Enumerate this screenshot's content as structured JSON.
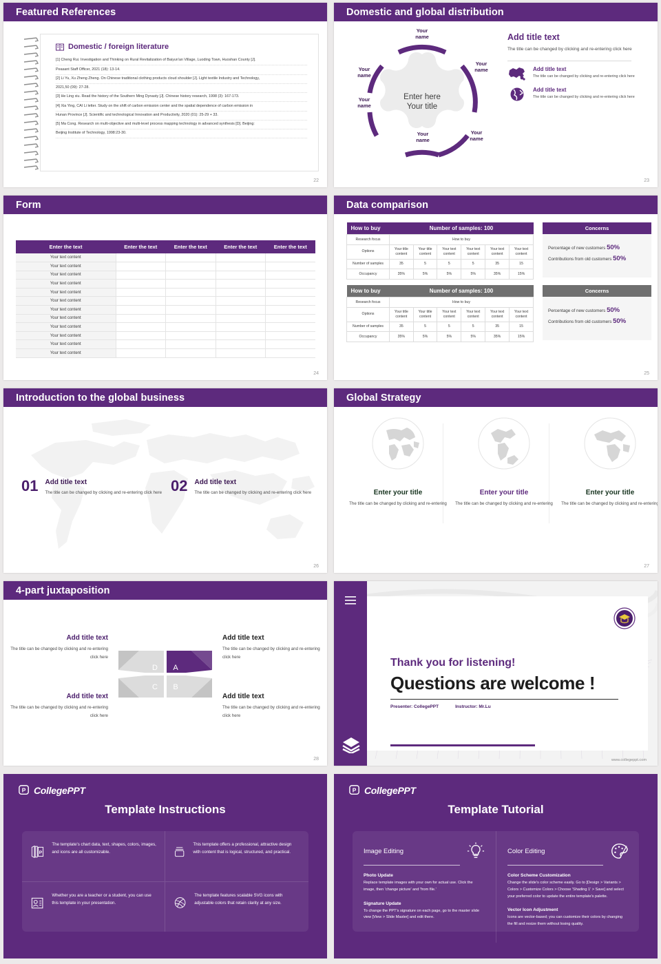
{
  "theme": {
    "purple": "#5d2a7d",
    "grey": "#6f6f6f",
    "dark": "#1d1d1d"
  },
  "slides": {
    "references": {
      "title": "Featured References",
      "page": "22",
      "card_title": "Domestic / foreign literature",
      "entries": [
        "[1] Cheng Rui. Investigation and Thinking on Rural Revitalization of Baiyun'an Village, Luoding Town, Huoshan County [J].",
        "Peasant Staff Officer, 2021 (18): 13-14.",
        "[2] Li Yu, Xu Zheng Zheng. On Chinese traditional clothing products cloud shoulder [J]. Light textile Industry and Technology,",
        "2021,50 (09): 27-28.",
        "[3] He Ling xiu. Read the history of the Southern Ming Dynasty [J]. Chinese history research, 1998 (3): 167-173.",
        "[4] Xia Ying, CAI Li letter. Study on the shift of carbon emission center and the spatial dependence of carbon emission in",
        "Hunan Province [J]. Scientific and technological Innovation and Productivity, 2020 (01): 25-29 + 33.",
        "[5] Ma Cong. Research on multi-objective and multi-level process mapping technology in advanced synthesis [D]. Beijing:",
        "Beijing Institute of Technology, 1998:23-30."
      ]
    },
    "distribution": {
      "title": "Domestic and global distribution",
      "page": "23",
      "center_line1": "Enter here",
      "center_line2": "Your title",
      "node_label": "Your\nname",
      "nodes": [
        "Your name",
        "Your name",
        "Your name",
        "Your name",
        "Your name",
        "Your name"
      ],
      "right_title": "Add title text",
      "right_body": "The title can be changed by clicking and re-entering click here",
      "items": [
        {
          "icon": "china-map-icon",
          "title": "Add title text",
          "body": "The title can be changed by clicking and re-entering click here"
        },
        {
          "icon": "globe-icon",
          "title": "Add title text",
          "body": "The title can be changed by clicking and re-entering click here"
        }
      ]
    },
    "form": {
      "title": "Form",
      "page": "24",
      "headers": [
        "Enter the text",
        "Enter the text",
        "Enter the text",
        "Enter the text",
        "Enter the text"
      ],
      "row_label": "Your text content",
      "row_count": 12
    },
    "comparison": {
      "title": "Data comparison",
      "page": "25",
      "tables": [
        {
          "accent": "purple",
          "bar_left": "How to buy",
          "bar_right": "Number of samples: 100",
          "focus_label": "Research focus",
          "focus_value": "How to buy",
          "options_label": "Options",
          "options": [
            "Your title content",
            "Your title content",
            "Your text content",
            "Your text content",
            "Your text content",
            "Your text content"
          ],
          "samples_label": "Number of samples",
          "samples": [
            "35",
            "5",
            "5",
            "5",
            "35",
            "15"
          ],
          "occupancy_label": "Occupancy",
          "occupancy": [
            "35%",
            "5%",
            "5%",
            "5%",
            "35%",
            "15%"
          ]
        },
        {
          "accent": "grey",
          "bar_left": "How to buy",
          "bar_right": "Number of samples: 100",
          "focus_label": "Research focus",
          "focus_value": "How to buy",
          "options_label": "Options",
          "options": [
            "Your title content",
            "Your title content",
            "Your text content",
            "Your text content",
            "Your text content",
            "Your text content"
          ],
          "samples_label": "Number of samples",
          "samples": [
            "35",
            "5",
            "5",
            "5",
            "35",
            "15"
          ],
          "occupancy_label": "Occupancy",
          "occupancy": [
            "35%",
            "5%",
            "5%",
            "5%",
            "35%",
            "15%"
          ]
        }
      ],
      "concerns": [
        {
          "accent": "purple",
          "caption": "Concerns",
          "line1": "Percentage of new customers",
          "value1": "50%",
          "line2": "Contributions from old customers",
          "value2": "50%"
        },
        {
          "accent": "grey",
          "caption": "Concerns",
          "line1": "Percentage of new customers",
          "value1": "50%",
          "line2": "Contributions from old customers",
          "value2": "50%"
        }
      ]
    },
    "global_business": {
      "title": "Introduction to the global business",
      "page": "26",
      "items": [
        {
          "num": "01",
          "title": "Add title text",
          "body": "The title can be changed by clicking and re-entering click here"
        },
        {
          "num": "02",
          "title": "Add title text",
          "body": "The title can be changed by clicking and re-entering click here"
        }
      ]
    },
    "global_strategy": {
      "title": "Global Strategy",
      "page": "27",
      "columns": [
        {
          "icon": "globe-icon",
          "title": "Enter your title",
          "color": "#16331e",
          "body": "The title can be changed by clicking and re-entering"
        },
        {
          "icon": "globe-icon",
          "title": "Enter your title",
          "color": "#5d2a7d",
          "body": "The title can be changed by clicking and re-entering"
        },
        {
          "icon": "globe-icon",
          "title": "Enter your title",
          "color": "#16331e",
          "body": "The title can be changed by clicking and re-entering"
        }
      ]
    },
    "juxtaposition": {
      "title": "4-part juxtaposition",
      "page": "28",
      "letters": [
        "A",
        "B",
        "C",
        "D"
      ],
      "quadrants": [
        {
          "pos": "top-left",
          "title": "Add title text",
          "color": "#4a1d6b",
          "align": "right",
          "body": "The title can be changed by clicking and re-entering click here"
        },
        {
          "pos": "top-right",
          "title": "Add title text",
          "color": "#1d1d1d",
          "align": "left",
          "body": "The title can be changed by clicking and re-entering click here"
        },
        {
          "pos": "bottom-left",
          "title": "Add title text",
          "color": "#4a1d6b",
          "align": "right",
          "body": "The title can be changed by clicking and re-entering click here"
        },
        {
          "pos": "bottom-right",
          "title": "Add title text",
          "color": "#1d1d1d",
          "align": "left",
          "body": "The title can be changed by clicking and re-entering click here"
        }
      ]
    },
    "thanks": {
      "page": "",
      "headline": "Thank you for listening!",
      "subline": "Questions are welcome !",
      "presenter": "Presenter: CollegePPT",
      "instructor": "Instructor: Mr.Lu",
      "url": "www.collegeppt.com",
      "menu_icon": "hamburger-icon",
      "layers_icon": "layers-icon",
      "badge_icon": "university-crest-icon"
    },
    "instructions": {
      "brand": "CollegePPT",
      "heading": "Template Instructions",
      "cards": [
        {
          "icon": "slides-p-icon",
          "text": "The template's chart data, text, shapes, colors, images, and icons are all customizable."
        },
        {
          "icon": "archive-box-icon",
          "text": "This template offers a professional, attractive design with content that is logical, structured, and practical."
        },
        {
          "icon": "id-card-icon",
          "text": "Whether you are a teacher or a student, you can use this template in your presentation."
        },
        {
          "icon": "dribbble-ball-icon",
          "text": "The template features scalable SVG icons with adjustable colors that retain clarity at any size."
        }
      ]
    },
    "tutorial": {
      "brand": "CollegePPT",
      "heading": "Template Tutorial",
      "columns": [
        {
          "title": "Image Editing",
          "icon": "lightbulb-icon",
          "sections": [
            {
              "head": "Photo Update",
              "body": "Replace template images with your own for actual use. Click the image, then 'change picture' and 'from file.'"
            },
            {
              "head": "Signature Update",
              "body": "To change the PPT's signature on each page, go to the master slide view [View > Slide Master] and edit there."
            }
          ]
        },
        {
          "title": "Color Editing",
          "icon": "palette-icon",
          "sections": [
            {
              "head": "Color Scheme Customization",
              "body": "Change the slide's color scheme easily. Go to [Design > Variants > Colors > Customize Colors > Choose 'Shading 1' > Save] and select your preferred color to update the entire template's palette."
            },
            {
              "head": "Vector Icon Adjustment",
              "body": "Icons are vector-based; you can customize their colors by changing the fill and resize them without losing quality."
            }
          ]
        }
      ]
    }
  }
}
